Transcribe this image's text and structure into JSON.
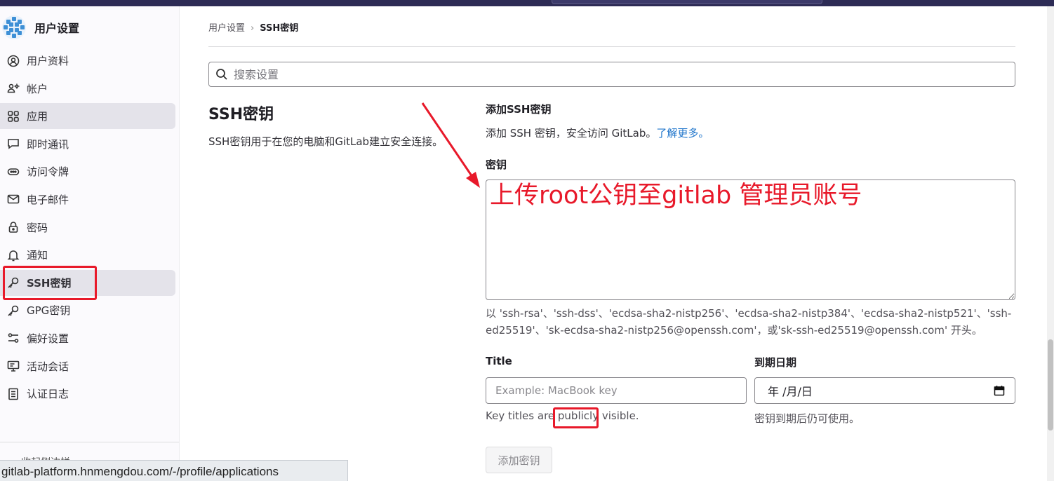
{
  "sidebar": {
    "title": "用户设置",
    "items": [
      {
        "label": "用户资料",
        "icon": "user-circle-icon"
      },
      {
        "label": "帐户",
        "icon": "account-gear-icon"
      },
      {
        "label": "应用",
        "icon": "applications-grid-icon"
      },
      {
        "label": "即时通讯",
        "icon": "chat-icon"
      },
      {
        "label": "访问令牌",
        "icon": "token-icon"
      },
      {
        "label": "电子邮件",
        "icon": "mail-icon"
      },
      {
        "label": "密码",
        "icon": "lock-icon"
      },
      {
        "label": "通知",
        "icon": "bell-icon"
      },
      {
        "label": "SSH密钥",
        "icon": "key-icon"
      },
      {
        "label": "GPG密钥",
        "icon": "key-icon"
      },
      {
        "label": "偏好设置",
        "icon": "preferences-icon"
      },
      {
        "label": "活动会话",
        "icon": "monitor-icon"
      },
      {
        "label": "认证日志",
        "icon": "log-icon"
      }
    ],
    "collapse_label": "收起侧边栏"
  },
  "status_url": "gitlab-platform.hnmengdou.com/-/profile/applications",
  "breadcrumb": {
    "parent": "用户设置",
    "current": "SSH密钥"
  },
  "search": {
    "placeholder": "搜索设置"
  },
  "section": {
    "title": "SSH密钥",
    "description": "SSH密钥用于在您的电脑和GitLab建立安全连接。"
  },
  "form": {
    "add_heading": "添加SSH密钥",
    "add_text": "添加 SSH 密钥，安全访问 GitLab。",
    "learn_more": "了解更多。",
    "key_label": "密钥",
    "key_help": "以 'ssh-rsa'、'ssh-dss'、'ecdsa-sha2-nistp256'、'ecdsa-sha2-nistp384'、'ecdsa-sha2-nistp521'、'ssh-ed25519'、'sk-ecdsa-sha2-nistp256@openssh.com'，或'sk-ssh-ed25519@openssh.com' 开头。",
    "title_label": "Title",
    "title_placeholder": "Example: MacBook key",
    "title_help_pre": "Key titles are ",
    "title_help_emph": "publicly",
    "title_help_post": " visible.",
    "expires_label": "到期日期",
    "expires_value": "年 /月/日",
    "expires_help": "密钥到期后仍可使用。",
    "add_button": "添加密钥"
  },
  "annotation": {
    "text": "上传root公钥至gitlab 管理员账号",
    "color": "#e8192a"
  },
  "colors": {
    "link": "#1f75cb",
    "annotation_red": "#e8192a",
    "topbar": "#2d2b55"
  }
}
